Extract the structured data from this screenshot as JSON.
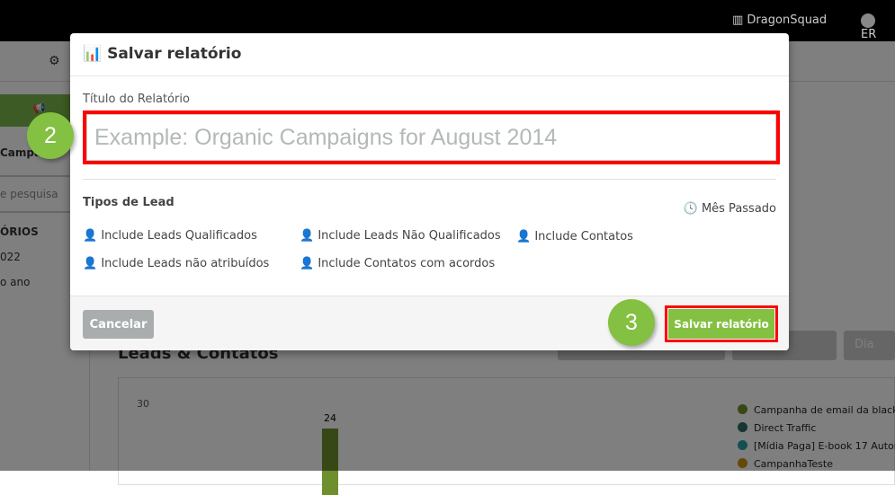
{
  "topbar": {
    "org": "DragonSquad",
    "user": "ER"
  },
  "sidebar": {
    "campaign": "Campa...",
    "search_placeholder": "e pesquisa",
    "section": "ÓRIOS",
    "item1": "022",
    "item2": "o ano"
  },
  "main": {
    "title": "Leads & Contatos",
    "day_button": "Dia"
  },
  "chart_data": {
    "type": "bar",
    "ytick": "30",
    "bar_label": "24",
    "values": [
      24
    ],
    "legend": [
      {
        "name": "Campanha de email da black f",
        "color": "#6f8f2c"
      },
      {
        "name": "Direct Traffic",
        "color": "#2d6b66"
      },
      {
        "name": "[Mídia Paga] E-book 17 Autor",
        "color": "#2a9fa8"
      },
      {
        "name": "CampanhaTeste",
        "color": "#c8920f"
      }
    ]
  },
  "modal": {
    "title": "Salvar relatório",
    "icon": "bar-chart-icon",
    "field_label": "Título do Relatório",
    "field_value": "",
    "field_placeholder": "Example: Organic Campaigns for August 2014",
    "lead_types_label": "Tipos de Lead",
    "period": "Mês Passado",
    "options": [
      "Include Leads Qualificados",
      "Include Leads Não Qualificados",
      "Include Contatos",
      "Include Leads não atribuídos",
      "Include Contatos com acordos"
    ],
    "cancel": "Cancelar",
    "save": "Salvar relatório"
  },
  "steps": {
    "field": "2",
    "save": "3"
  },
  "colors": {
    "accent": "#84c041",
    "highlight": "#ff0000"
  }
}
